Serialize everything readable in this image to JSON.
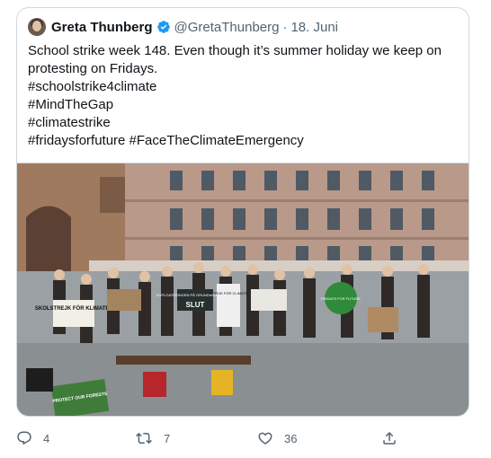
{
  "tweet": {
    "author_name": "Greta Thunberg",
    "handle": "@GretaThunberg",
    "separator": "·",
    "date": "18. Juni",
    "text_lines": [
      "School strike week 148. Even though it’s summer holiday we keep on",
      "protesting on Fridays.",
      "#schoolstrike4climate",
      "#MindTheGap",
      "#climatestrike",
      "#fridaysforfuture #FaceTheClimateEmergency"
    ],
    "photo": {
      "signs": [
        "SKOLSTREJK FÖR KLIMATET",
        "EXPLOATERINGEN PÅ GRUNDNIVÅ ÄR SLUT",
        "SLUT",
        "STREJK FÖR CLIMATE",
        "FRIDAYS FOR FUTURE",
        "PROTECT OUR FORESTS"
      ]
    }
  },
  "actions": {
    "reply_count": "4",
    "retweet_count": "7",
    "like_count": "36"
  },
  "colors": {
    "verified": "#1d9bf0",
    "muted_text": "#536471",
    "border": "#cfd9de"
  }
}
